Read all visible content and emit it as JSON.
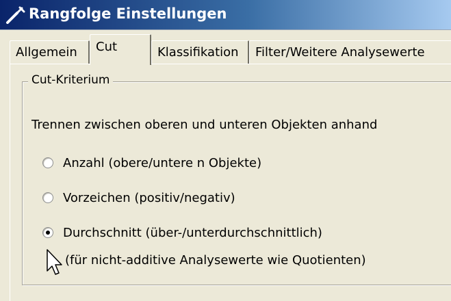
{
  "window": {
    "title": "Rangfolge Einstellungen",
    "icon": "wrench-icon"
  },
  "tabs": [
    {
      "label": "Allgemein",
      "active": false
    },
    {
      "label": "Cut",
      "active": true
    },
    {
      "label": "Klassifikation",
      "active": false
    },
    {
      "label": "Filter/Weitere Analysewerte",
      "active": false
    }
  ],
  "cut_group": {
    "legend": "Cut-Kriterium",
    "description": "Trennen zwischen oberen und unteren Objekten anhand",
    "options": [
      {
        "label": "Anzahl (obere/untere n Objekte)",
        "selected": false
      },
      {
        "label": "Vorzeichen (positiv/negativ)",
        "selected": false
      },
      {
        "label": "Durchschnitt (über-/unterdurchschnittlich)",
        "selected": true
      }
    ],
    "hint": "(für nicht-additive Analysewerte wie Quotienten)"
  }
}
